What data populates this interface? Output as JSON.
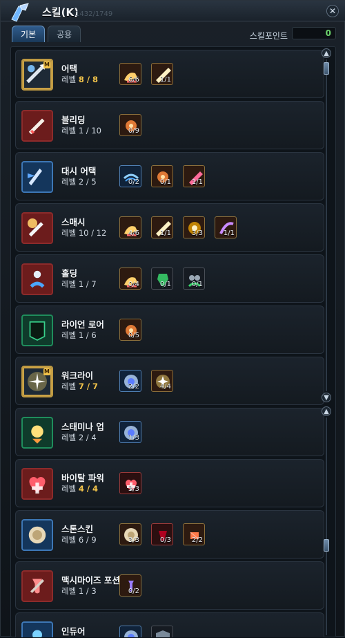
{
  "window": {
    "title": "스킬(K)",
    "background_overlay": "1432/1749",
    "close_symbol": "✕"
  },
  "tabs": [
    {
      "label": "기본",
      "active": true
    },
    {
      "label": "공용",
      "active": false
    }
  ],
  "skill_points": {
    "label": "스킬포인트",
    "value": "0",
    "value_color": "#6bd36b"
  },
  "skills": [
    {
      "name": "어택",
      "level_prefix": "레벨 ",
      "level": "8 / 8",
      "level_highlight": true,
      "icon": "sword-strike-icon",
      "icon_style": "gold",
      "perks": [
        {
          "icon": "strength-arm-icon",
          "count": "6/6"
        },
        {
          "icon": "sword-boost-icon",
          "count": "1/1"
        }
      ]
    },
    {
      "name": "블리딩",
      "level_prefix": "레벨 ",
      "level": "1 / 10",
      "level_highlight": false,
      "icon": "bleeding-blade-icon",
      "icon_style": "red",
      "perks": [
        {
          "icon": "burst-icon",
          "count": "0/9"
        }
      ]
    },
    {
      "name": "대시 어택",
      "level_prefix": "레벨 ",
      "level": "2 / 5",
      "level_highlight": false,
      "icon": "dash-attack-icon",
      "icon_style": "blue",
      "perks": [
        {
          "icon": "wind-icon",
          "count": "0/2"
        },
        {
          "icon": "burst-icon",
          "count": "0/1"
        },
        {
          "icon": "dash-strike-icon",
          "count": "1/1"
        }
      ]
    },
    {
      "name": "스매시",
      "level_prefix": "레벨 ",
      "level": "10 / 12",
      "level_highlight": false,
      "icon": "smash-icon",
      "icon_style": "red",
      "perks": [
        {
          "icon": "strength-arm-icon",
          "count": "4/6"
        },
        {
          "icon": "sword-boost-icon",
          "count": "1/1"
        },
        {
          "icon": "shockwave-icon",
          "count": "3/3"
        },
        {
          "icon": "swipe-icon",
          "count": "1/1"
        }
      ]
    },
    {
      "name": "홀딩",
      "level_prefix": "레벨 ",
      "level": "1 / 7",
      "level_highlight": false,
      "icon": "holding-icon",
      "icon_style": "red",
      "perks": [
        {
          "icon": "strength-arm-icon",
          "count": "0/4"
        },
        {
          "icon": "armor-icon",
          "count": "0/1"
        },
        {
          "icon": "duo-icon",
          "count": "0/1"
        }
      ]
    },
    {
      "name": "라이언 로어",
      "level_prefix": "레벨 ",
      "level": "1 / 6",
      "level_highlight": false,
      "icon": "lion-roar-icon",
      "icon_style": "green",
      "perks": [
        {
          "icon": "burst-icon",
          "count": "0/5"
        }
      ]
    },
    {
      "name": "워크라이",
      "level_prefix": "레벨 ",
      "level": "7 / 7",
      "level_highlight": true,
      "icon": "war-cry-icon",
      "icon_style": "gold",
      "perks": [
        {
          "icon": "rune-circle-icon",
          "count": "2/2"
        },
        {
          "icon": "war-cry-boost-icon",
          "count": "4/4"
        }
      ]
    },
    {
      "name": "스태미나 업",
      "level_prefix": "레벨 ",
      "level": "2 / 4",
      "level_highlight": false,
      "icon": "stamina-up-icon",
      "icon_style": "green",
      "perks": [
        {
          "icon": "rune-circle-icon",
          "count": "1/3"
        }
      ]
    },
    {
      "name": "바이탈 파워",
      "level_prefix": "레벨 ",
      "level": "4 / 4",
      "level_highlight": true,
      "icon": "vital-power-icon",
      "icon_style": "red",
      "perks": [
        {
          "icon": "heart-plus-icon",
          "count": "3/3"
        }
      ]
    },
    {
      "name": "스톤스킨",
      "level_prefix": "레벨 ",
      "level": "6 / 9",
      "level_highlight": false,
      "icon": "stone-skin-icon",
      "icon_style": "blue",
      "perks": [
        {
          "icon": "stone-skin-boost-icon",
          "count": "3/3"
        },
        {
          "icon": "crest-icon",
          "count": "0/3"
        },
        {
          "icon": "fist-icon",
          "count": "2/2"
        }
      ]
    },
    {
      "name": "맥시마이즈 포션",
      "level_prefix": "레벨 ",
      "level": "1 / 3",
      "level_highlight": false,
      "icon": "potion-icon",
      "icon_style": "red",
      "perks": [
        {
          "icon": "potion-mini-icon",
          "count": "0/2"
        }
      ]
    },
    {
      "name": "인듀어",
      "level_prefix": "",
      "level": "",
      "level_highlight": false,
      "icon": "endure-icon",
      "icon_style": "blue",
      "perks": [
        {
          "icon": "rune-circle-icon",
          "count": ""
        },
        {
          "icon": "shield-icon",
          "count": ""
        }
      ]
    }
  ]
}
